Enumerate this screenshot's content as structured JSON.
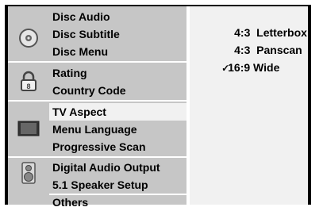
{
  "menu": {
    "groups": [
      {
        "icon": "disc-icon",
        "items": [
          "Disc Audio",
          "Disc Subtitle",
          "Disc Menu"
        ]
      },
      {
        "icon": "lock-icon",
        "items": [
          "Rating",
          "Country Code"
        ]
      },
      {
        "icon": "tv-icon",
        "items": [
          "TV Aspect",
          "Menu Language",
          "Progressive Scan"
        ]
      },
      {
        "icon": "speaker-icon",
        "items": [
          "Digital Audio Output",
          "5.1 Speaker Setup"
        ]
      },
      {
        "icon": "",
        "items": [
          "Others"
        ]
      }
    ],
    "selected": "TV Aspect"
  },
  "options": {
    "items": [
      {
        "label": "4:3  Letterbox",
        "checked": false
      },
      {
        "label": "4:3  Panscan",
        "checked": false
      },
      {
        "label": "16:9 Wide",
        "checked": true
      }
    ],
    "check_mark": "✓"
  },
  "colors": {
    "menu_bg": "#c6c6c6",
    "panel_bg": "#f1f1f1",
    "frame": "#000000"
  }
}
